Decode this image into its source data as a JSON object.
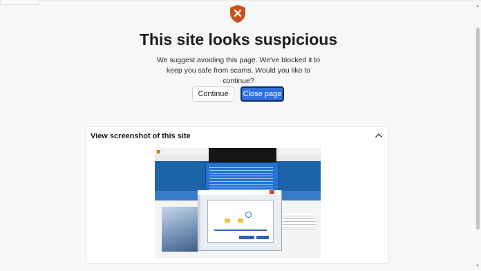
{
  "page": {
    "title": "This site looks suspicious",
    "description": "We suggest avoiding this page. We've blocked it to keep you safe from scams. Would you like to continue?",
    "continue_label": "Continue",
    "close_label": "Close page",
    "shield_icon": "shield-x-icon",
    "shield_color": "#c9501e",
    "accent_color": "#2f6fdf"
  },
  "screenshot_panel": {
    "title": "View screenshot of this site",
    "toggle_icon": "chevron-up-icon",
    "image_alt": "Screenshot of suspicious site showing fake Microsoft support pop-ups"
  }
}
